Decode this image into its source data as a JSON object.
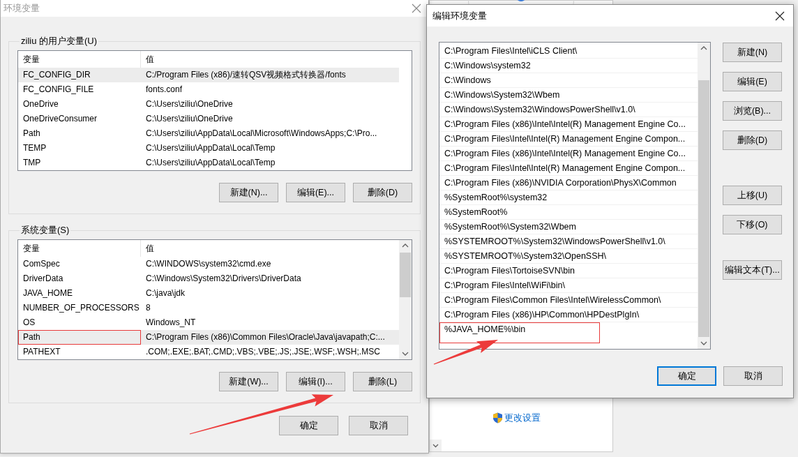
{
  "background_window": {
    "link": "更改设置"
  },
  "env_dialog": {
    "title": "环境变量",
    "user_vars": {
      "legend": "ziliu 的用户变量(U)",
      "columns": [
        "变量",
        "值"
      ],
      "scrollbar": false,
      "rows": [
        {
          "name": "FC_CONFIG_DIR",
          "value": "C:/Program Files (x86)/速转QSV视频格式转换器/fonts",
          "selected": true,
          "highlighted": false
        },
        {
          "name": "FC_CONFIG_FILE",
          "value": "fonts.conf",
          "selected": false,
          "highlighted": false
        },
        {
          "name": "OneDrive",
          "value": "C:\\Users\\ziliu\\OneDrive",
          "selected": false,
          "highlighted": false
        },
        {
          "name": "OneDriveConsumer",
          "value": "C:\\Users\\ziliu\\OneDrive",
          "selected": false,
          "highlighted": false
        },
        {
          "name": "Path",
          "value": "C:\\Users\\ziliu\\AppData\\Local\\Microsoft\\WindowsApps;C:\\Pro...",
          "selected": false,
          "highlighted": false
        },
        {
          "name": "TEMP",
          "value": "C:\\Users\\ziliu\\AppData\\Local\\Temp",
          "selected": false,
          "highlighted": false
        },
        {
          "name": "TMP",
          "value": "C:\\Users\\ziliu\\AppData\\Local\\Temp",
          "selected": false,
          "highlighted": false
        }
      ],
      "buttons": [
        "新建(N)...",
        "编辑(E)...",
        "删除(D)"
      ]
    },
    "system_vars": {
      "legend": "系统变量(S)",
      "columns": [
        "变量",
        "值"
      ],
      "scrollbar": true,
      "rows": [
        {
          "name": "ComSpec",
          "value": "C:\\WINDOWS\\system32\\cmd.exe",
          "selected": false,
          "highlighted": false
        },
        {
          "name": "DriverData",
          "value": "C:\\Windows\\System32\\Drivers\\DriverData",
          "selected": false,
          "highlighted": false
        },
        {
          "name": "JAVA_HOME",
          "value": "C:\\java\\jdk",
          "selected": false,
          "highlighted": false
        },
        {
          "name": "NUMBER_OF_PROCESSORS",
          "value": "8",
          "selected": false,
          "highlighted": false
        },
        {
          "name": "OS",
          "value": "Windows_NT",
          "selected": false,
          "highlighted": false
        },
        {
          "name": "Path",
          "value": "C:\\Program Files (x86)\\Common Files\\Oracle\\Java\\javapath;C:...",
          "selected": true,
          "highlighted": true
        },
        {
          "name": "PATHEXT",
          "value": ".COM;.EXE;.BAT;.CMD;.VBS;.VBE;.JS;.JSE;.WSF;.WSH;.MSC",
          "selected": false,
          "highlighted": false
        }
      ],
      "buttons": [
        "新建(W)...",
        "编辑(I)...",
        "删除(L)"
      ]
    },
    "buttons": [
      {
        "label": "确定",
        "default": false
      },
      {
        "label": "取消",
        "default": false
      }
    ]
  },
  "edit_dialog": {
    "title": "编辑环境变量",
    "entries": [
      {
        "text": "C:\\Program Files\\Intel\\iCLS Client\\",
        "selected": false,
        "highlighted": false
      },
      {
        "text": "C:\\Windows\\system32",
        "selected": false,
        "highlighted": false
      },
      {
        "text": "C:\\Windows",
        "selected": false,
        "highlighted": false
      },
      {
        "text": "C:\\Windows\\System32\\Wbem",
        "selected": false,
        "highlighted": false
      },
      {
        "text": "C:\\Windows\\System32\\WindowsPowerShell\\v1.0\\",
        "selected": false,
        "highlighted": false
      },
      {
        "text": "C:\\Program Files (x86)\\Intel\\Intel(R) Management Engine Co...",
        "selected": false,
        "highlighted": false
      },
      {
        "text": "C:\\Program Files\\Intel\\Intel(R) Management Engine Compon...",
        "selected": false,
        "highlighted": false
      },
      {
        "text": "C:\\Program Files (x86)\\Intel\\Intel(R) Management Engine Co...",
        "selected": false,
        "highlighted": false
      },
      {
        "text": "C:\\Program Files\\Intel\\Intel(R) Management Engine Compon...",
        "selected": false,
        "highlighted": false
      },
      {
        "text": "C:\\Program Files (x86)\\NVIDIA Corporation\\PhysX\\Common",
        "selected": false,
        "highlighted": false
      },
      {
        "text": "%SystemRoot%\\system32",
        "selected": false,
        "highlighted": false
      },
      {
        "text": "%SystemRoot%",
        "selected": false,
        "highlighted": false
      },
      {
        "text": "%SystemRoot%\\System32\\Wbem",
        "selected": false,
        "highlighted": false
      },
      {
        "text": "%SYSTEMROOT%\\System32\\WindowsPowerShell\\v1.0\\",
        "selected": false,
        "highlighted": false
      },
      {
        "text": "%SYSTEMROOT%\\System32\\OpenSSH\\",
        "selected": false,
        "highlighted": false
      },
      {
        "text": "C:\\Program Files\\TortoiseSVN\\bin",
        "selected": false,
        "highlighted": false
      },
      {
        "text": "C:\\Program Files\\Intel\\WiFi\\bin\\",
        "selected": false,
        "highlighted": false
      },
      {
        "text": "C:\\Program Files\\Common Files\\Intel\\WirelessCommon\\",
        "selected": false,
        "highlighted": false
      },
      {
        "text": "C:\\Program Files (x86)\\HP\\Common\\HPDestPlgIn\\",
        "selected": false,
        "highlighted": false
      },
      {
        "text": "%JAVA_HOME%\\bin",
        "selected": false,
        "highlighted": true
      }
    ],
    "side_button_groups": [
      [
        "新建(N)",
        "编辑(E)",
        "浏览(B)...",
        "删除(D)"
      ],
      [
        "上移(U)",
        "下移(O)"
      ],
      [
        "编辑文本(T)..."
      ]
    ],
    "buttons": [
      {
        "label": "确定",
        "default": true
      },
      {
        "label": "取消",
        "default": false
      }
    ]
  }
}
